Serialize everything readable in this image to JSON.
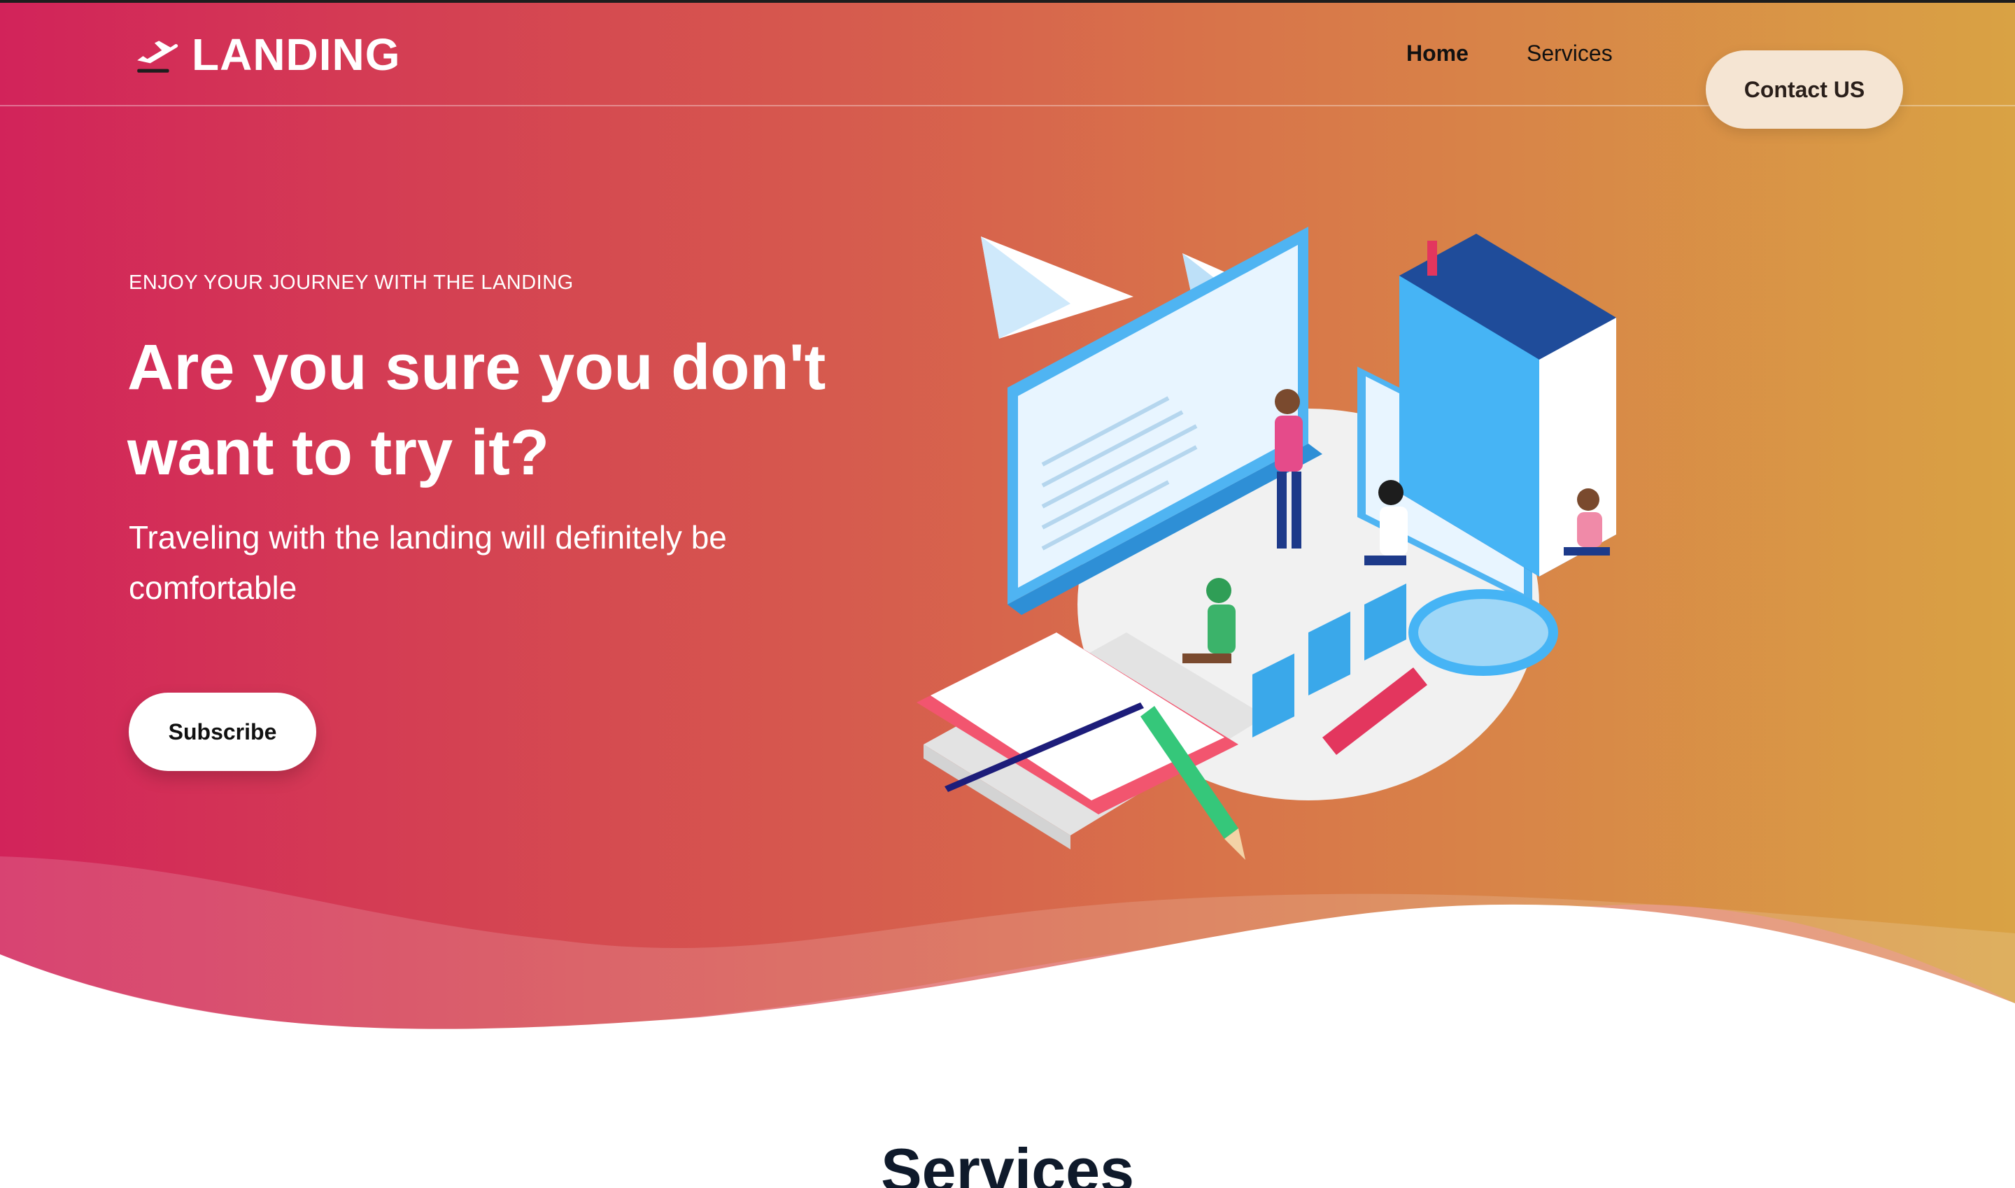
{
  "brand": {
    "name": "LANDING",
    "icon": "airplane-takeoff-icon"
  },
  "nav": {
    "items": [
      {
        "label": "Home",
        "active": true
      },
      {
        "label": "Services",
        "active": false
      }
    ],
    "cta_label": "Contact US"
  },
  "hero": {
    "eyebrow": "ENJOY YOUR JOURNEY WITH THE LANDING",
    "headline": "Are you sure you don't want to try it?",
    "subtext": "Traveling with the landing will definitely be comfortable",
    "subscribe_label": "Subscribe"
  },
  "services": {
    "title": "Services"
  },
  "colors": {
    "gradient_start": "#d2235a",
    "gradient_end": "#d9a244",
    "cta_background": "#f5e5d3",
    "text_dark": "#0f1a2b"
  }
}
